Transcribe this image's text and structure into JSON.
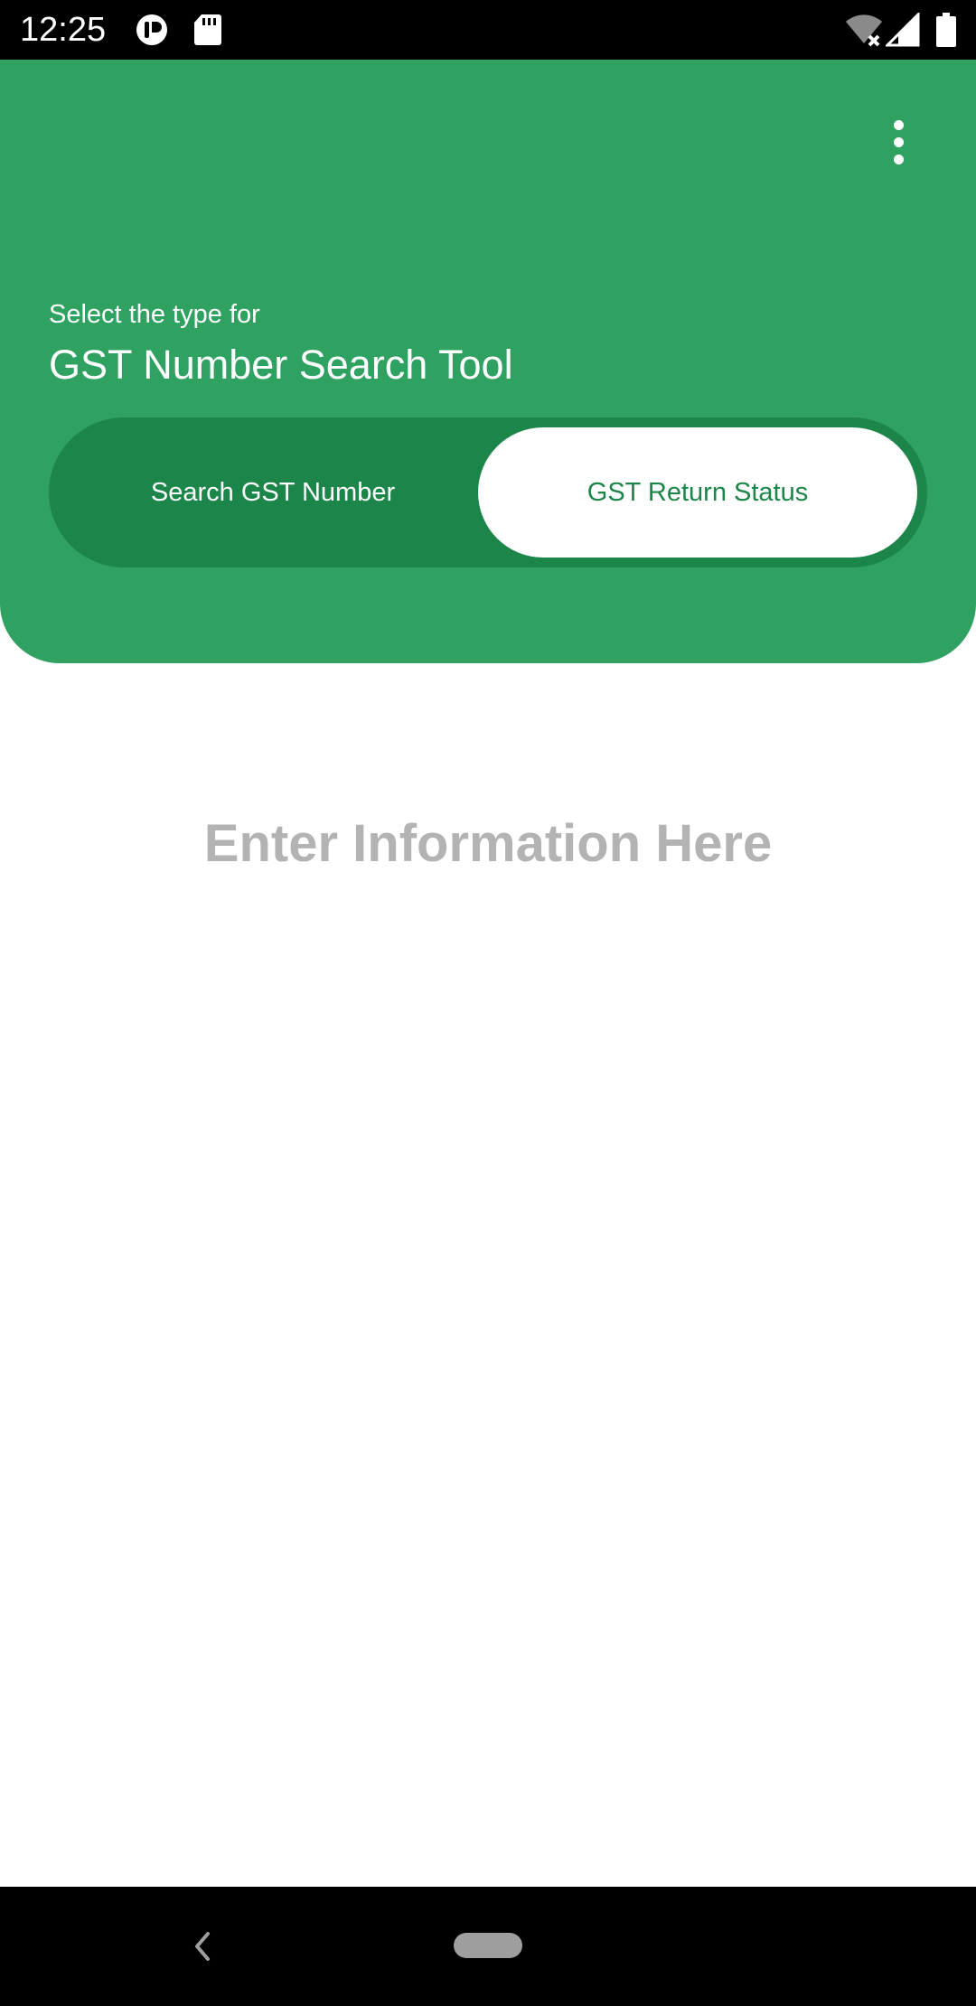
{
  "status_bar": {
    "time": "12:25",
    "icons": [
      "app-notification-icon",
      "sd-card-icon",
      "wifi-off-icon",
      "signal-icon",
      "battery-icon"
    ]
  },
  "header": {
    "menu_icon": "more-vert-icon",
    "subtitle": "Select the type for",
    "title": "GST Number Search Tool",
    "toggle": {
      "options": [
        "Search GST Number",
        "GST Return Status"
      ],
      "selected": "GST Return Status"
    }
  },
  "main": {
    "hint": "Enter Information Here"
  },
  "nav_bar": {
    "icons": [
      "back-icon",
      "home-pill-icon"
    ]
  },
  "colors": {
    "header_green": "#2fa160",
    "toggle_track": "#1c8549",
    "hint_gray": "#b3b3b3",
    "system_bar": "#000000"
  }
}
